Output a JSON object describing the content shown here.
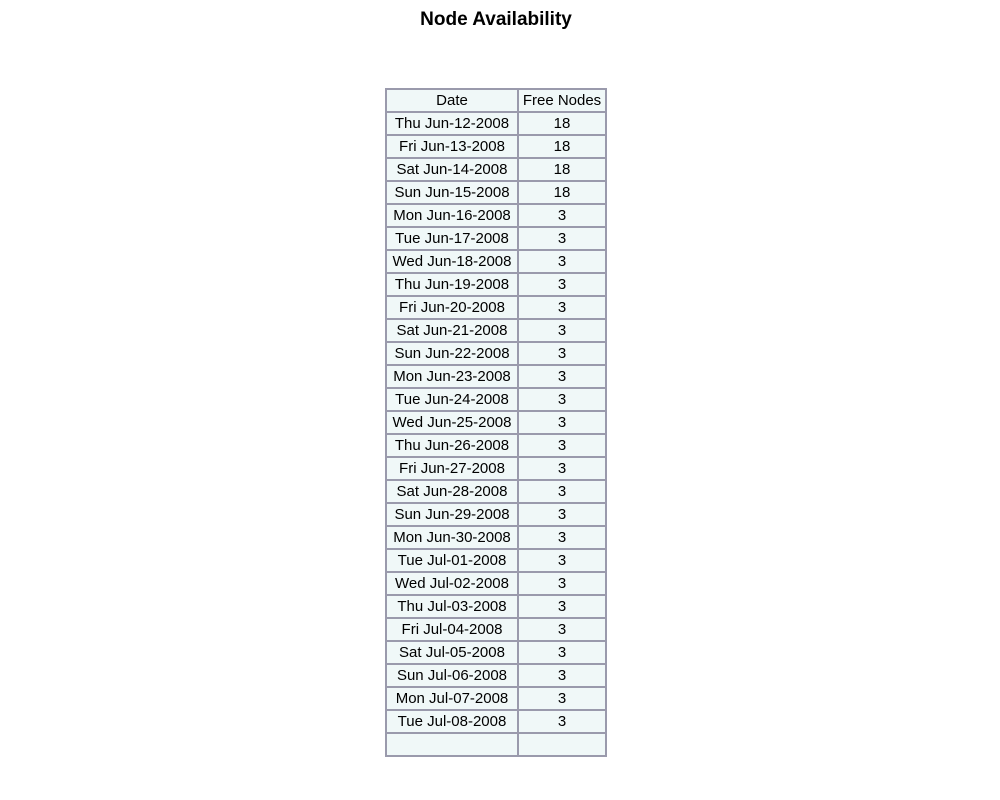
{
  "page": {
    "title": "Node Availability"
  },
  "table": {
    "headers": {
      "date": "Date",
      "free_nodes": "Free Nodes"
    },
    "rows": [
      {
        "date": "Thu Jun-12-2008",
        "free_nodes": "18"
      },
      {
        "date": "Fri Jun-13-2008",
        "free_nodes": "18"
      },
      {
        "date": "Sat Jun-14-2008",
        "free_nodes": "18"
      },
      {
        "date": "Sun Jun-15-2008",
        "free_nodes": "18"
      },
      {
        "date": "Mon Jun-16-2008",
        "free_nodes": "3"
      },
      {
        "date": "Tue Jun-17-2008",
        "free_nodes": "3"
      },
      {
        "date": "Wed Jun-18-2008",
        "free_nodes": "3"
      },
      {
        "date": "Thu Jun-19-2008",
        "free_nodes": "3"
      },
      {
        "date": "Fri Jun-20-2008",
        "free_nodes": "3"
      },
      {
        "date": "Sat Jun-21-2008",
        "free_nodes": "3"
      },
      {
        "date": "Sun Jun-22-2008",
        "free_nodes": "3"
      },
      {
        "date": "Mon Jun-23-2008",
        "free_nodes": "3"
      },
      {
        "date": "Tue Jun-24-2008",
        "free_nodes": "3"
      },
      {
        "date": "Wed Jun-25-2008",
        "free_nodes": "3"
      },
      {
        "date": "Thu Jun-26-2008",
        "free_nodes": "3"
      },
      {
        "date": "Fri Jun-27-2008",
        "free_nodes": "3"
      },
      {
        "date": "Sat Jun-28-2008",
        "free_nodes": "3"
      },
      {
        "date": "Sun Jun-29-2008",
        "free_nodes": "3"
      },
      {
        "date": "Mon Jun-30-2008",
        "free_nodes": "3"
      },
      {
        "date": "Tue Jul-01-2008",
        "free_nodes": "3"
      },
      {
        "date": "Wed Jul-02-2008",
        "free_nodes": "3"
      },
      {
        "date": "Thu Jul-03-2008",
        "free_nodes": "3"
      },
      {
        "date": "Fri Jul-04-2008",
        "free_nodes": "3"
      },
      {
        "date": "Sat Jul-05-2008",
        "free_nodes": "3"
      },
      {
        "date": "Sun Jul-06-2008",
        "free_nodes": "3"
      },
      {
        "date": "Mon Jul-07-2008",
        "free_nodes": "3"
      },
      {
        "date": "Tue Jul-08-2008",
        "free_nodes": "3"
      },
      {
        "date": "",
        "free_nodes": ""
      }
    ]
  },
  "colors": {
    "cell_background": "#f0f8f8",
    "border": "#9a9aac"
  }
}
